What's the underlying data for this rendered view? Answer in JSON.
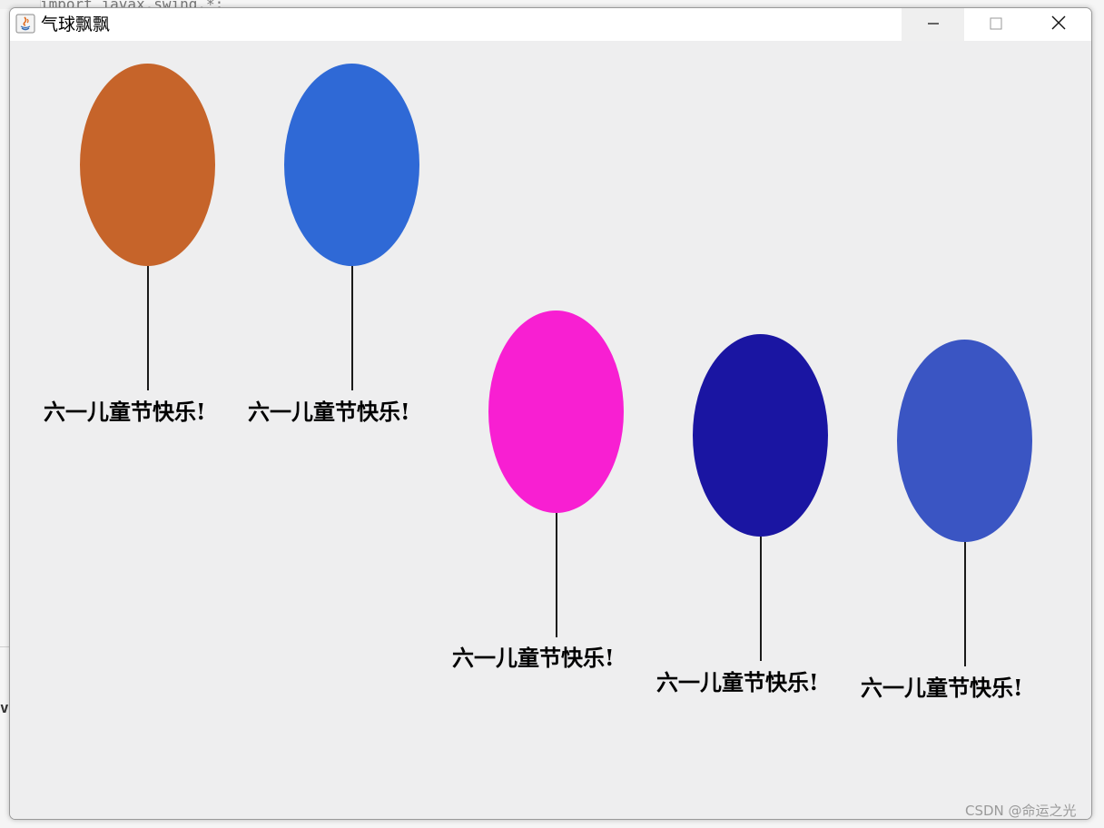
{
  "background": {
    "code_snippet": "import javax.swing.*;",
    "side_letter": "v"
  },
  "window": {
    "title": "气球飘飘",
    "controls": {
      "minimize_icon": "minimize-icon",
      "maximize_icon": "maximize-icon",
      "close_icon": "close-icon"
    }
  },
  "balloons": [
    {
      "color": "#c6642a",
      "greeting": "六一儿童节快乐!"
    },
    {
      "color": "#2f69d6",
      "greeting": "六一儿童节快乐!"
    },
    {
      "color": "#f81fd2",
      "greeting": "六一儿童节快乐!"
    },
    {
      "color": "#1a15a2",
      "greeting": "六一儿童节快乐!"
    },
    {
      "color": "#3a55c3",
      "greeting": "六一儿童节快乐!"
    }
  ],
  "watermark": "CSDN @命运之光"
}
